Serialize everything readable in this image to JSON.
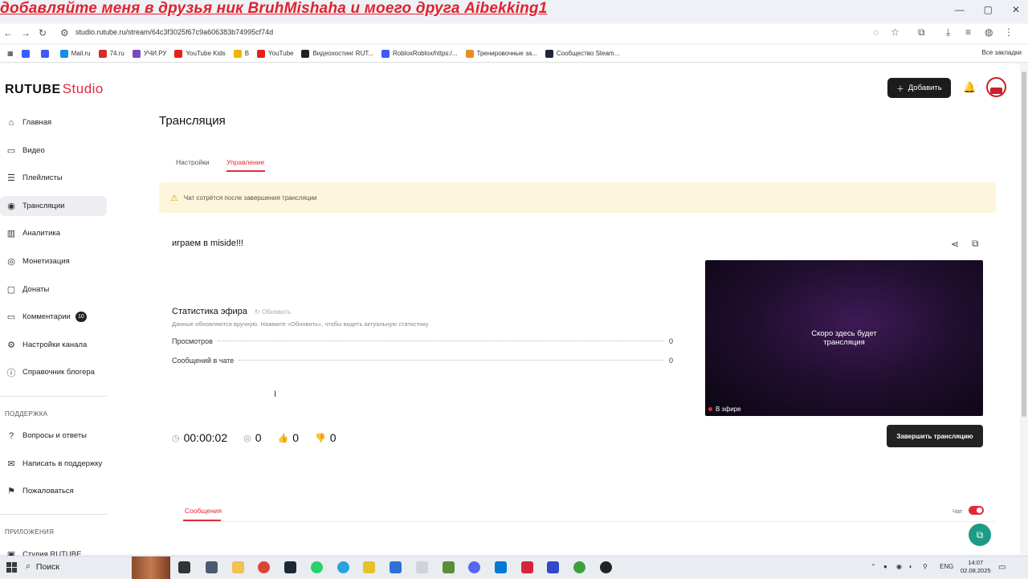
{
  "overlay": {
    "text": "добавляйте меня в друзья ник BruhMishaha и моего друга Aibekking1"
  },
  "browser": {
    "url": "studio.rutube.ru/stream/64c3f3025f67c9a606383b74995cf74d",
    "window_controls": [
      "—",
      "▢",
      "✕"
    ],
    "bookmarks": [
      {
        "label": "Mail.ru",
        "color": "#168de2"
      },
      {
        "label": "74.ru",
        "color": "#d62b2b"
      },
      {
        "label": "УЧИ.РУ",
        "color": "#7a49c2"
      },
      {
        "label": "YouTube Kids",
        "color": "#e62117"
      },
      {
        "label": "В",
        "color": "#f1b400"
      },
      {
        "label": "YouTube",
        "color": "#e62117"
      },
      {
        "label": "Видеохостинг RUT...",
        "color": "#222222"
      },
      {
        "label": "RobloxRoblox/https:/...",
        "color": "#3d5afe"
      },
      {
        "label": "Тренировочные за...",
        "color": "#e98b1e"
      },
      {
        "label": "Сообщество Steam...",
        "color": "#1b2838"
      }
    ],
    "all_bookmarks": "Все закладки"
  },
  "header": {
    "logo_main": "RUTUBE",
    "logo_sub": "Studio",
    "add_button": "Добавить"
  },
  "sidebar": {
    "items": [
      {
        "label": "Главная",
        "icon": "home-icon",
        "glyph": "⌂"
      },
      {
        "label": "Видео",
        "icon": "video-icon",
        "glyph": "▭"
      },
      {
        "label": "Плейлисты",
        "icon": "playlist-icon",
        "glyph": "☰"
      },
      {
        "label": "Трансляции",
        "icon": "broadcast-icon",
        "glyph": "◉",
        "active": true
      },
      {
        "label": "Аналитика",
        "icon": "analytics-icon",
        "glyph": "▥"
      },
      {
        "label": "Монетизация",
        "icon": "monetization-icon",
        "glyph": "◎"
      },
      {
        "label": "Донаты",
        "icon": "donate-icon",
        "glyph": "▢"
      },
      {
        "label": "Комментарии",
        "icon": "comments-icon",
        "glyph": "▭",
        "badge": "10"
      },
      {
        "label": "Настройки канала",
        "icon": "gear-icon",
        "glyph": "⚙"
      },
      {
        "label": "Справочник блогера",
        "icon": "info-icon",
        "glyph": "ⓘ"
      }
    ],
    "support_heading": "ПОДДЕРЖКА",
    "support_items": [
      {
        "label": "Вопросы и ответы",
        "icon": "help-icon",
        "glyph": "?"
      },
      {
        "label": "Написать в поддержку",
        "icon": "mail-icon",
        "glyph": "✉"
      },
      {
        "label": "Пожаловаться",
        "icon": "flag-icon",
        "glyph": "⚑"
      }
    ],
    "apps_heading": "ПРИЛОЖЕНИЯ",
    "apps_items": [
      {
        "label": "Студия RUTUBE",
        "icon": "app-icon",
        "glyph": "▣"
      }
    ]
  },
  "main": {
    "page_title": "Трансляция",
    "tabs": [
      "Настройки",
      "Управление"
    ],
    "active_tab": "Управление",
    "warning": "Чат сотрётся после завершения трансляции",
    "stream": {
      "title": "играем в miside!!!",
      "stats_title": "Статистика эфира",
      "refresh": "Обновить",
      "stats_hint": "Данные обновляются вручную. Нажмите «Обновить», чтобы видеть актуальную статистику",
      "rows": [
        {
          "label": "Просмотров",
          "value": "0"
        },
        {
          "label": "Сообщений в чате",
          "value": "0"
        }
      ],
      "timer": "00:00:02",
      "viewers": "0",
      "likes": "0",
      "dislikes": "0",
      "player_text_1": "Скоро здесь будет",
      "player_text_2": "трансляция",
      "live_label": "В эфире",
      "end_button": "Завершить трансляцию"
    },
    "chat": {
      "tab": "Сообщения",
      "toggle_label": "Чат",
      "toggle_on": true
    }
  },
  "taskbar": {
    "search": "Поиск",
    "lang": "ENG",
    "time": "14:07",
    "date": "02.08.2025"
  }
}
